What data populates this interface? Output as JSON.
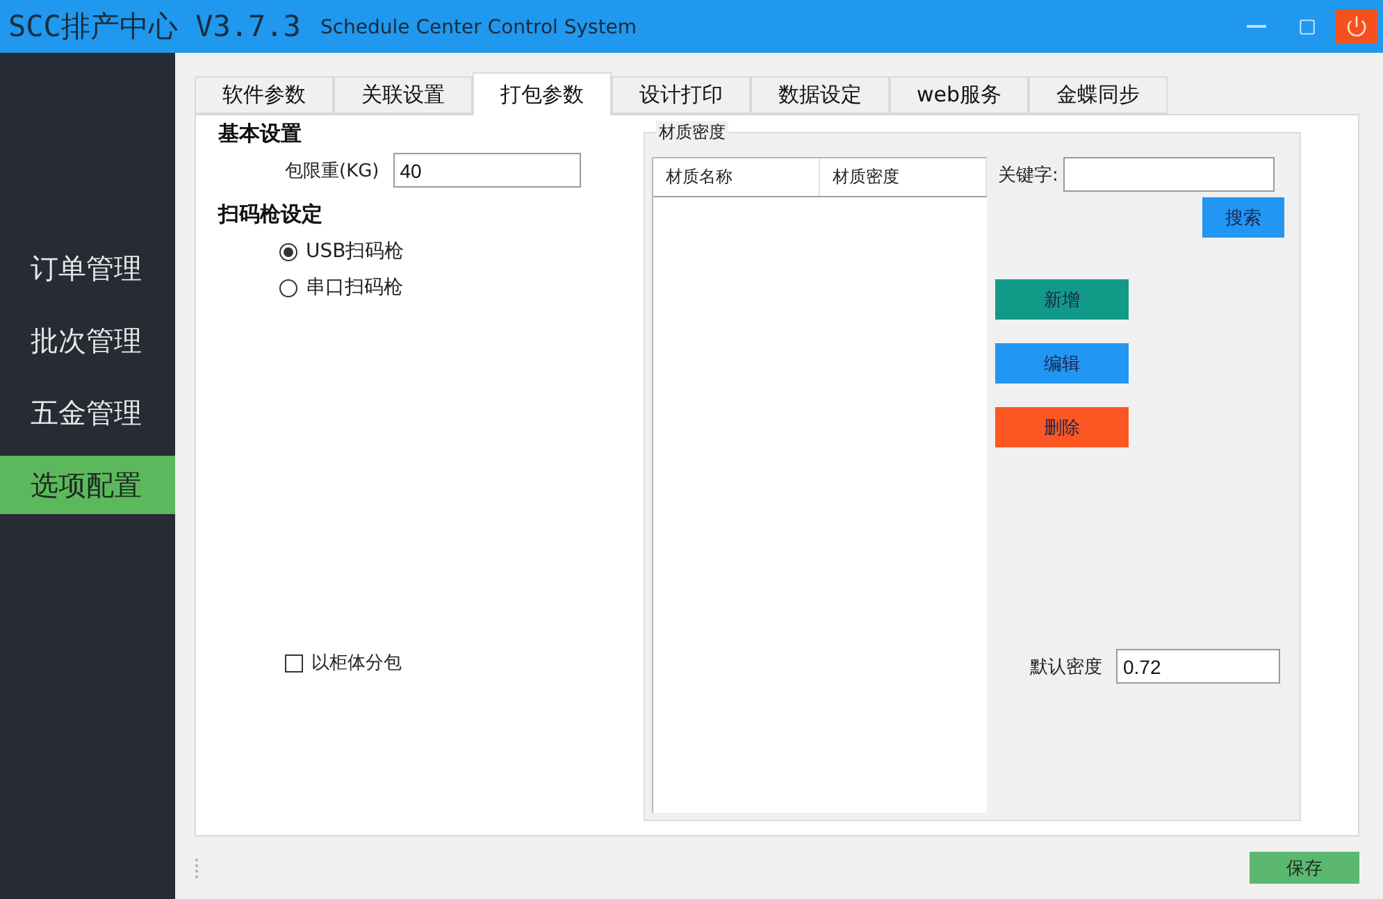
{
  "window": {
    "title": "SCC排产中心 V3.7.3",
    "subtitle": "Schedule Center Control System"
  },
  "sidebar": {
    "items": [
      {
        "label": "订单管理",
        "selected": false
      },
      {
        "label": "批次管理",
        "selected": false
      },
      {
        "label": "五金管理",
        "selected": false
      },
      {
        "label": "选项配置",
        "selected": true
      }
    ]
  },
  "tabs": [
    {
      "label": "软件参数",
      "selected": false
    },
    {
      "label": "关联设置",
      "selected": false
    },
    {
      "label": "打包参数",
      "selected": true
    },
    {
      "label": "设计打印",
      "selected": false
    },
    {
      "label": "数据设定",
      "selected": false
    },
    {
      "label": "web服务",
      "selected": false
    },
    {
      "label": "金蝶同步",
      "selected": false
    }
  ],
  "basic": {
    "heading": "基本设置",
    "weight_label": "包限重(KG)",
    "weight_value": "40"
  },
  "scanner": {
    "heading": "扫码枪设定",
    "options": [
      {
        "label": "USB扫码枪",
        "selected": true
      },
      {
        "label": "串口扫码枪",
        "selected": false
      }
    ]
  },
  "split_by_cabinet": {
    "label": "以柜体分包",
    "checked": false
  },
  "density_group": {
    "title": "材质密度",
    "columns": [
      "材质名称",
      "材质密度"
    ],
    "keyword_label": "关键字:",
    "search_button": "搜索",
    "buttons": [
      {
        "label": "新增",
        "kind": "add"
      },
      {
        "label": "编辑",
        "kind": "edit"
      },
      {
        "label": "删除",
        "kind": "delete"
      }
    ],
    "default_label": "默认密度",
    "default_value": "0.72"
  },
  "save_button": "保存"
}
